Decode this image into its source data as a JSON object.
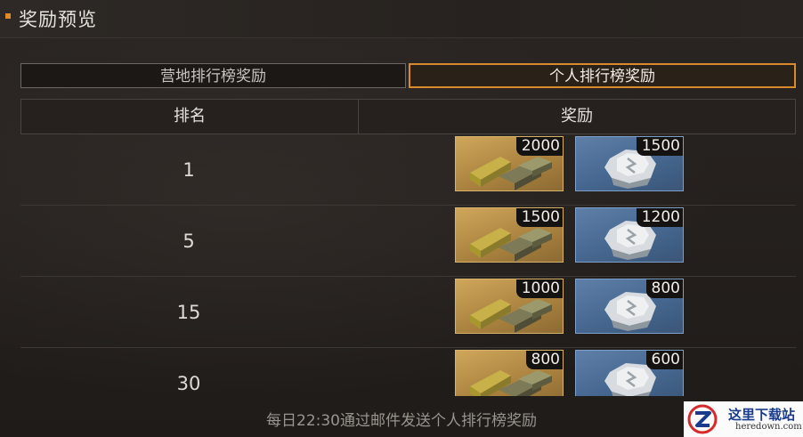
{
  "header": {
    "title": "奖励预览"
  },
  "tabs": [
    {
      "label": "营地排行榜奖励",
      "active": false
    },
    {
      "label": "个人排行榜奖励",
      "active": true
    }
  ],
  "table": {
    "col_rank": "排名",
    "col_reward": "奖励",
    "rows": [
      {
        "rank": "1",
        "gold": "2000",
        "crystal": "1500"
      },
      {
        "rank": "5",
        "gold": "1500",
        "crystal": "1200"
      },
      {
        "rank": "15",
        "gold": "1000",
        "crystal": "800"
      },
      {
        "rank": "30",
        "gold": "800",
        "crystal": "600"
      }
    ]
  },
  "footer": {
    "note": "每日22:30通过邮件发送个人排行榜奖励"
  },
  "watermark": {
    "cn": "这里下载站",
    "en": "heredown.com"
  },
  "icons": {
    "gold": "gold-bars-icon",
    "crystal": "silver-crystal-icon"
  },
  "colors": {
    "accent": "#d98a2c",
    "gold_tile": "#c39a52",
    "crystal_tile": "#4f6f97"
  }
}
